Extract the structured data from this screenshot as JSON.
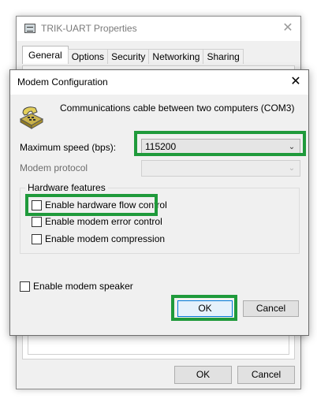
{
  "properties_window": {
    "title": "TRIK-UART Properties",
    "close_glyph": "✕",
    "tabs": [
      {
        "label": "General",
        "active": true
      },
      {
        "label": "Options",
        "active": false
      },
      {
        "label": "Security",
        "active": false
      },
      {
        "label": "Networking",
        "active": false
      },
      {
        "label": "Sharing",
        "active": false
      }
    ],
    "ok_label": "OK",
    "cancel_label": "Cancel"
  },
  "modem_dialog": {
    "title": "Modem Configuration",
    "close_glyph": "✕",
    "device_icon": "telephone-modem-icon",
    "device_name": "Communications cable between two computers (COM3)",
    "max_speed": {
      "label": "Maximum speed (bps):",
      "value": "115200",
      "arrow_glyph": "⌄"
    },
    "modem_protocol": {
      "label": "Modem protocol",
      "value": "",
      "enabled": false,
      "arrow_glyph": "⌄"
    },
    "hardware_features": {
      "legend": "Hardware features",
      "options": [
        {
          "label": "Enable hardware flow control",
          "checked": false
        },
        {
          "label": "Enable modem error control",
          "checked": false
        },
        {
          "label": "Enable modem compression",
          "checked": false
        }
      ]
    },
    "speaker_option": {
      "label": "Enable modem speaker",
      "checked": false
    },
    "ok_label": "OK",
    "cancel_label": "Cancel"
  },
  "colors": {
    "highlight": "#1f9a3b",
    "default_button_border": "#0078d7"
  }
}
